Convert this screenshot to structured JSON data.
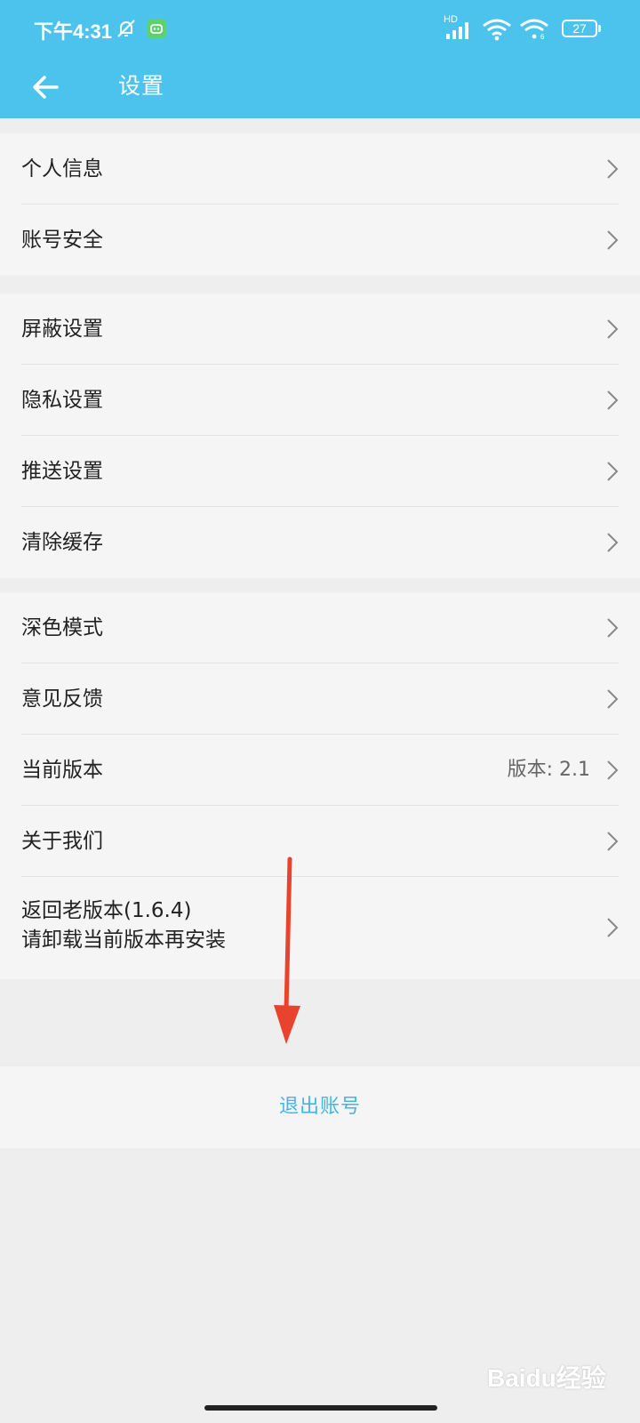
{
  "status_bar": {
    "time": "下午4:31",
    "network_badge": "HD",
    "battery": "27",
    "icons": [
      "bell-off-icon",
      "app-badge-icon",
      "signal-icon",
      "wifi-icon",
      "wifi-6-icon",
      "battery-icon"
    ]
  },
  "header": {
    "title": "设置",
    "back_icon": "arrow-left-icon",
    "background": "#4cc3ed"
  },
  "groups": [
    {
      "items": [
        {
          "label": "个人信息"
        },
        {
          "label": "账号安全"
        }
      ]
    },
    {
      "items": [
        {
          "label": "屏蔽设置"
        },
        {
          "label": "隐私设置"
        },
        {
          "label": "推送设置"
        },
        {
          "label": "清除缓存"
        }
      ]
    },
    {
      "items": [
        {
          "label": "深色模式"
        },
        {
          "label": "意见反馈"
        },
        {
          "label": "当前版本",
          "value": "版本: 2.1"
        },
        {
          "label": "关于我们"
        },
        {
          "label": "返回老版本(1.6.4)",
          "label2": "请卸载当前版本再安装"
        }
      ]
    }
  ],
  "logout": {
    "label": "退出账号",
    "color": "#3fb7e3"
  },
  "annotation": {
    "arrow_color": "#e8432c"
  },
  "watermark": {
    "text": "Baidu经验"
  }
}
